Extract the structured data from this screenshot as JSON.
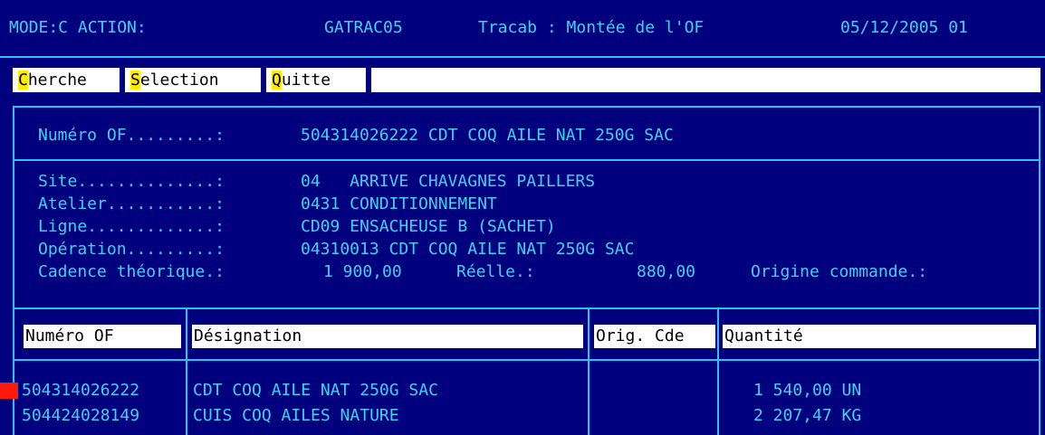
{
  "header": {
    "mode": "MODE:C ACTION:",
    "program": "GATRAC05",
    "title": "Tracab : Montée de l'OF",
    "date": "05/12/2005 01"
  },
  "menu": [
    {
      "hotkey": "C",
      "rest": "herche"
    },
    {
      "hotkey": "S",
      "rest": "election"
    },
    {
      "hotkey": "Q",
      "rest": "uitte"
    }
  ],
  "of_line": {
    "label": "Numéro OF.........:",
    "value": "504314026222 CDT COQ AILE NAT 250G SAC"
  },
  "details": {
    "site_label": "Site..............:",
    "site_value": "04   ARRIVE CHAVAGNES PAILLERS",
    "atelier_label": "Atelier...........:",
    "atelier_value": "0431 CONDITIONNEMENT",
    "ligne_label": "Ligne.............:",
    "ligne_value": "CD09 ENSACHEUSE B (SACHET)",
    "operation_label": "Opération.........:",
    "operation_value": "04310013 CDT COQ AILE NAT 250G SAC",
    "cadence_label": "Cadence théorique.:",
    "cadence_value": "1 900,00",
    "reelle_label": "Réelle.:",
    "reelle_value": "880,00",
    "origine_label": "Origine commande.:"
  },
  "table": {
    "columns": [
      "Numéro OF",
      "Désignation",
      "Orig. Cde",
      "Quantité"
    ],
    "rows": [
      {
        "numero": "504314026222",
        "designation": "CDT COQ AILE NAT 250G SAC",
        "orig": "",
        "quantite": "1 540,00 UN"
      },
      {
        "numero": "504424028149",
        "designation": "CUIS COQ AILES NATURE",
        "orig": "",
        "quantite": "2 207,47 KG"
      }
    ]
  },
  "colors": {
    "background": "#00007e",
    "text": "#3fd2f4",
    "border": "#2ac2ee",
    "hotkey": "#ffec00",
    "selection_marker": "#ff1a10"
  }
}
